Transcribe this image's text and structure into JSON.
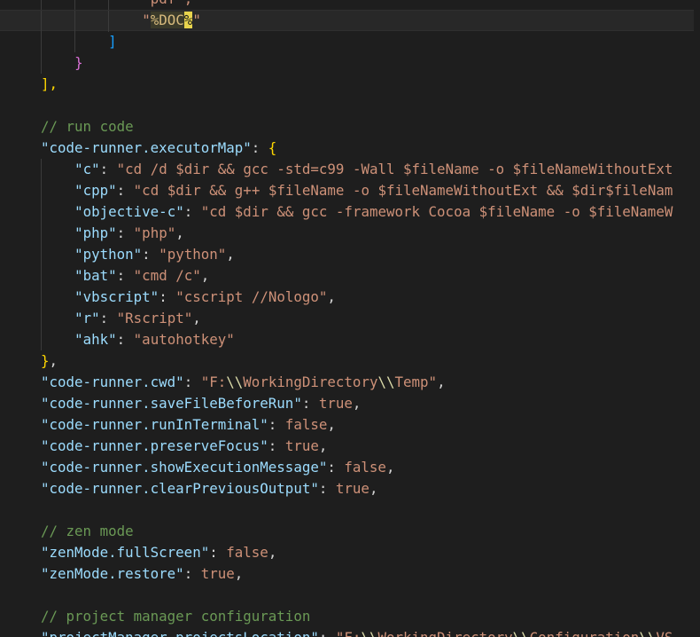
{
  "editor": {
    "lines": [
      {
        "indent": 12,
        "tokens": [
          {
            "t": "\"pdf\",",
            "c": "t-s"
          }
        ]
      },
      {
        "indent": 12,
        "current": true,
        "tokens": [
          {
            "t": "\"",
            "c": "t-s"
          },
          {
            "t": "%DOC",
            "c": "t-s hl-doc"
          },
          {
            "t": "%",
            "c": "t-s cursor-ch"
          },
          {
            "t": "\"",
            "c": "t-s"
          }
        ]
      },
      {
        "indent": 8,
        "tokens": [
          {
            "t": "]",
            "c": "t-brk3"
          }
        ]
      },
      {
        "indent": 4,
        "tokens": [
          {
            "t": "}",
            "c": "t-brk2"
          }
        ]
      },
      {
        "indent": 0,
        "tokens": [
          {
            "t": "],",
            "c": "t-brk1"
          }
        ]
      },
      {
        "indent": 0,
        "tokens": []
      },
      {
        "indent": 0,
        "tokens": [
          {
            "t": "// run code",
            "c": "t-c"
          }
        ]
      },
      {
        "indent": 0,
        "tokens": [
          {
            "t": "\"code-runner.executorMap\"",
            "c": "t-k"
          },
          {
            "t": ": ",
            "c": "t-p"
          },
          {
            "t": "{",
            "c": "t-brk1"
          }
        ]
      },
      {
        "indent": 4,
        "tokens": [
          {
            "t": "\"c\"",
            "c": "t-k"
          },
          {
            "t": ": ",
            "c": "t-p"
          },
          {
            "t": "\"cd /d $dir && gcc -std=c99 -Wall $fileName -o $fileNameWithoutExt",
            "c": "t-s"
          }
        ]
      },
      {
        "indent": 4,
        "tokens": [
          {
            "t": "\"cpp\"",
            "c": "t-k"
          },
          {
            "t": ": ",
            "c": "t-p"
          },
          {
            "t": "\"cd $dir && g++ $fileName -o $fileNameWithoutExt && $dir$fileNam",
            "c": "t-s"
          }
        ]
      },
      {
        "indent": 4,
        "tokens": [
          {
            "t": "\"objective-c\"",
            "c": "t-k"
          },
          {
            "t": ": ",
            "c": "t-p"
          },
          {
            "t": "\"cd $dir && gcc -framework Cocoa $fileName -o $fileNameW",
            "c": "t-s"
          }
        ]
      },
      {
        "indent": 4,
        "tokens": [
          {
            "t": "\"php\"",
            "c": "t-k"
          },
          {
            "t": ": ",
            "c": "t-p"
          },
          {
            "t": "\"php\"",
            "c": "t-s"
          },
          {
            "t": ",",
            "c": "t-p"
          }
        ]
      },
      {
        "indent": 4,
        "tokens": [
          {
            "t": "\"python\"",
            "c": "t-k"
          },
          {
            "t": ": ",
            "c": "t-p"
          },
          {
            "t": "\"python\"",
            "c": "t-s"
          },
          {
            "t": ",",
            "c": "t-p"
          }
        ]
      },
      {
        "indent": 4,
        "tokens": [
          {
            "t": "\"bat\"",
            "c": "t-k"
          },
          {
            "t": ": ",
            "c": "t-p"
          },
          {
            "t": "\"cmd /c\"",
            "c": "t-s"
          },
          {
            "t": ",",
            "c": "t-p"
          }
        ]
      },
      {
        "indent": 4,
        "tokens": [
          {
            "t": "\"vbscript\"",
            "c": "t-k"
          },
          {
            "t": ": ",
            "c": "t-p"
          },
          {
            "t": "\"cscript //Nologo\"",
            "c": "t-s"
          },
          {
            "t": ",",
            "c": "t-p"
          }
        ]
      },
      {
        "indent": 4,
        "tokens": [
          {
            "t": "\"r\"",
            "c": "t-k"
          },
          {
            "t": ": ",
            "c": "t-p"
          },
          {
            "t": "\"Rscript\"",
            "c": "t-s"
          },
          {
            "t": ",",
            "c": "t-p"
          }
        ]
      },
      {
        "indent": 4,
        "tokens": [
          {
            "t": "\"ahk\"",
            "c": "t-k"
          },
          {
            "t": ": ",
            "c": "t-p"
          },
          {
            "t": "\"autohotkey\"",
            "c": "t-s"
          }
        ]
      },
      {
        "indent": 0,
        "tokens": [
          {
            "t": "}",
            "c": "t-brk1"
          },
          {
            "t": ",",
            "c": "t-p"
          }
        ]
      },
      {
        "indent": 0,
        "tokens": [
          {
            "t": "\"code-runner.cwd\"",
            "c": "t-k"
          },
          {
            "t": ": ",
            "c": "t-p"
          },
          {
            "t": "\"F:",
            "c": "t-s"
          },
          {
            "t": "\\\\",
            "c": "t-yel"
          },
          {
            "t": "WorkingDirectory",
            "c": "t-s"
          },
          {
            "t": "\\\\",
            "c": "t-yel"
          },
          {
            "t": "Temp\"",
            "c": "t-s"
          },
          {
            "t": ",",
            "c": "t-p"
          }
        ]
      },
      {
        "indent": 0,
        "tokens": [
          {
            "t": "\"code-runner.saveFileBeforeRun\"",
            "c": "t-k"
          },
          {
            "t": ": ",
            "c": "t-p"
          },
          {
            "t": "true",
            "c": "t-s"
          },
          {
            "t": ",",
            "c": "t-p"
          }
        ]
      },
      {
        "indent": 0,
        "tokens": [
          {
            "t": "\"code-runner.runInTerminal\"",
            "c": "t-k"
          },
          {
            "t": ": ",
            "c": "t-p"
          },
          {
            "t": "false",
            "c": "t-s"
          },
          {
            "t": ",",
            "c": "t-p"
          }
        ]
      },
      {
        "indent": 0,
        "tokens": [
          {
            "t": "\"code-runner.preserveFocus\"",
            "c": "t-k"
          },
          {
            "t": ": ",
            "c": "t-p"
          },
          {
            "t": "true",
            "c": "t-s"
          },
          {
            "t": ",",
            "c": "t-p"
          }
        ]
      },
      {
        "indent": 0,
        "tokens": [
          {
            "t": "\"code-runner.showExecutionMessage\"",
            "c": "t-k"
          },
          {
            "t": ": ",
            "c": "t-p"
          },
          {
            "t": "false",
            "c": "t-s"
          },
          {
            "t": ",",
            "c": "t-p"
          }
        ]
      },
      {
        "indent": 0,
        "tokens": [
          {
            "t": "\"code-runner.clearPreviousOutput\"",
            "c": "t-k"
          },
          {
            "t": ": ",
            "c": "t-p"
          },
          {
            "t": "true",
            "c": "t-s"
          },
          {
            "t": ",",
            "c": "t-p"
          }
        ]
      },
      {
        "indent": 0,
        "tokens": []
      },
      {
        "indent": 0,
        "tokens": [
          {
            "t": "// zen mode",
            "c": "t-c"
          }
        ]
      },
      {
        "indent": 0,
        "tokens": [
          {
            "t": "\"zenMode.fullScreen\"",
            "c": "t-k"
          },
          {
            "t": ": ",
            "c": "t-p"
          },
          {
            "t": "false",
            "c": "t-s"
          },
          {
            "t": ",",
            "c": "t-p"
          }
        ]
      },
      {
        "indent": 0,
        "tokens": [
          {
            "t": "\"zenMode.restore\"",
            "c": "t-k"
          },
          {
            "t": ": ",
            "c": "t-p"
          },
          {
            "t": "true",
            "c": "t-s"
          },
          {
            "t": ",",
            "c": "t-p"
          }
        ]
      },
      {
        "indent": 0,
        "tokens": []
      },
      {
        "indent": 0,
        "tokens": [
          {
            "t": "// project manager configuration",
            "c": "t-c"
          }
        ]
      },
      {
        "indent": 0,
        "tokens": [
          {
            "t": "\"projectManager.projectsLocation\"",
            "c": "t-k"
          },
          {
            "t": ": ",
            "c": "t-p"
          },
          {
            "t": "\"F:",
            "c": "t-s"
          },
          {
            "t": "\\\\",
            "c": "t-yel"
          },
          {
            "t": "WorkingDirectory",
            "c": "t-s"
          },
          {
            "t": "\\\\",
            "c": "t-yel"
          },
          {
            "t": "Configuration",
            "c": "t-s"
          },
          {
            "t": "\\\\",
            "c": "t-yel"
          },
          {
            "t": "VS",
            "c": "t-s"
          }
        ]
      }
    ]
  },
  "colors": {
    "background": "#1e1e1e",
    "current_line": "#282828",
    "key": "#9cdcfe",
    "string": "#ce9178",
    "comment": "#6a9955",
    "escape": "#dcdcaa",
    "bracket_level1": "#ffd700",
    "bracket_level2": "#da70d6",
    "bracket_level3": "#179fff"
  }
}
